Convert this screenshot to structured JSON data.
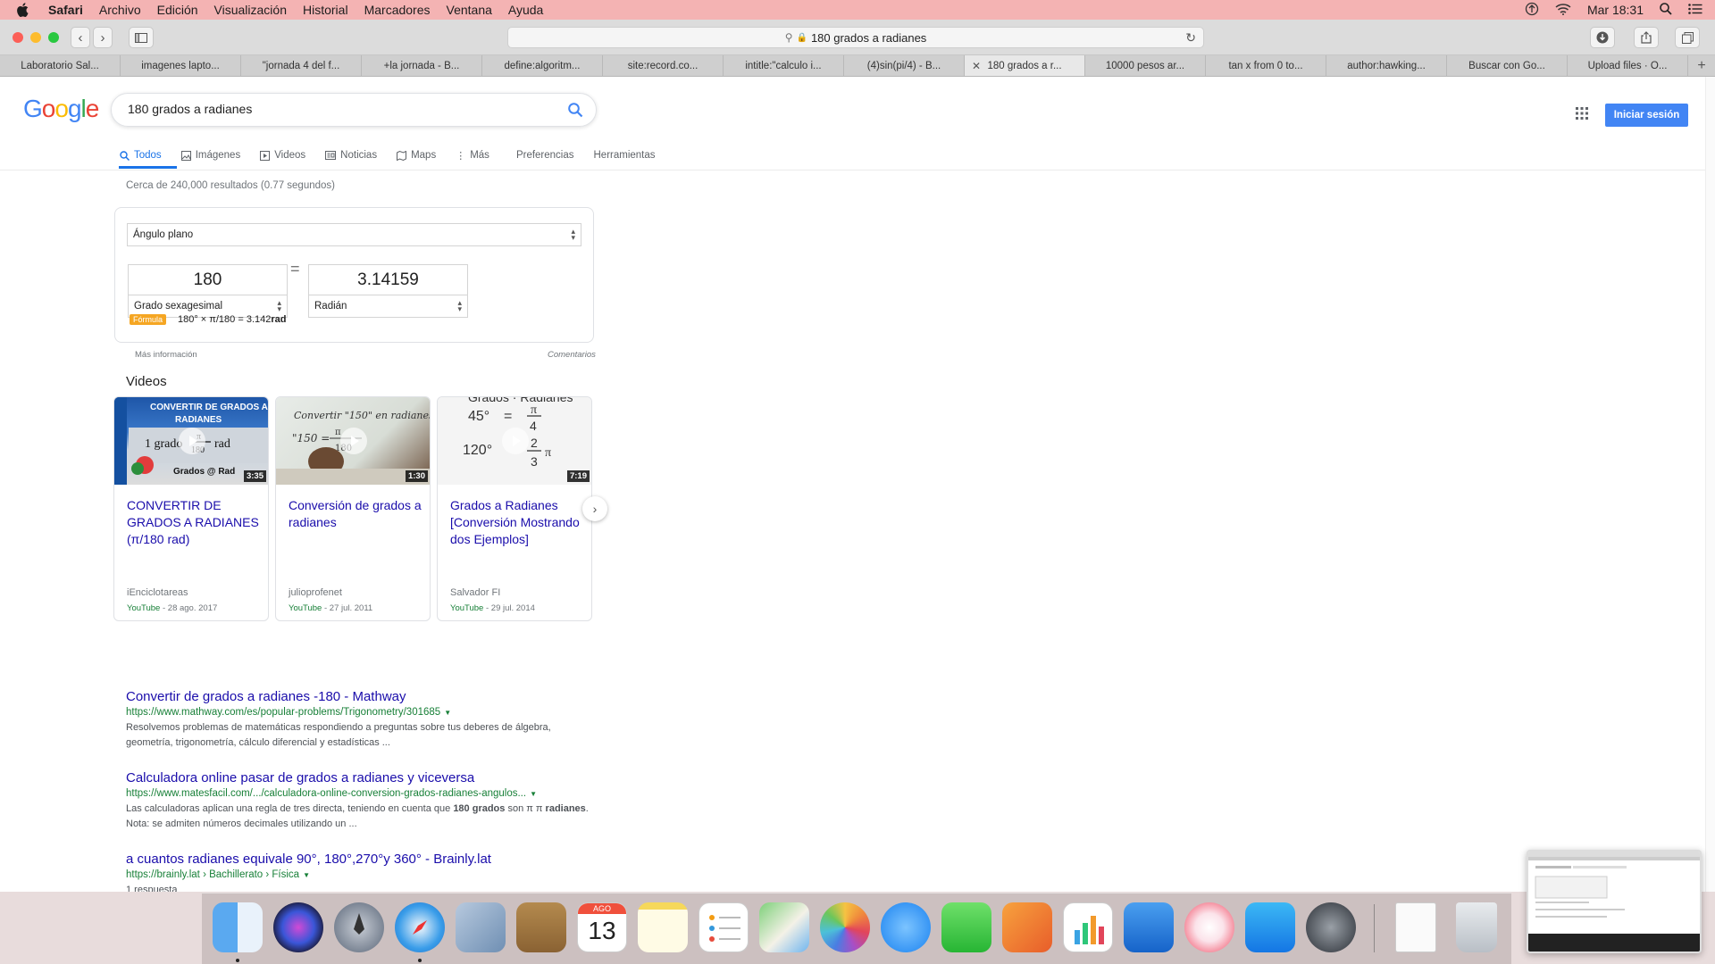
{
  "menubar": {
    "app": "Safari",
    "items": [
      "Archivo",
      "Edición",
      "Visualización",
      "Historial",
      "Marcadores",
      "Ventana",
      "Ayuda"
    ],
    "clock": "Mar 18:31"
  },
  "browser": {
    "address": "180 grados a radianes",
    "tabs": [
      "Laboratorio Sal...",
      "imagenes lapto...",
      "\"jornada 4 del f...",
      "+la jornada - B...",
      "define:algoritm...",
      "site:record.co...",
      "intitle:\"calculo i...",
      "(4)sin(pi/4) - B...",
      "180 grados a r...",
      "10000 pesos ar...",
      "tan x from 0 to...",
      "author:hawking...",
      "Buscar con Go...",
      "Upload files · O..."
    ]
  },
  "google": {
    "logo": "Google",
    "query": "180 grados a radianes",
    "signin": "Iniciar sesión",
    "nav": {
      "todos": "Todos",
      "imagenes": "Imágenes",
      "videos": "Videos",
      "noticias": "Noticias",
      "maps": "Maps",
      "mas": "Más",
      "preferencias": "Preferencias",
      "herramientas": "Herramientas"
    },
    "stats": "Cerca de 240,000 resultados (0.77 segundos)",
    "converter": {
      "unit_type": "Ángulo plano",
      "from_value": "180",
      "to_value": "3.14159",
      "from_unit": "Grado sexagesimal",
      "to_unit": "Radián",
      "formula_label": "Fórmula",
      "formula_text": "180° × π/180 = 3.142",
      "formula_unit": "rad",
      "more_info": "Más información",
      "comments": "Comentarios"
    },
    "videos_heading": "Videos",
    "videos": [
      {
        "title": "CONVERTIR DE GRADOS A RADIANES (π/180 rad)",
        "duration": "3:35",
        "channel": "iEnciclotareas",
        "source": "YouTube",
        "date": " - 28 ago. 2017"
      },
      {
        "title": "Conversión de grados a radianes",
        "duration": "1:30",
        "channel": "julioprofenet",
        "source": "YouTube",
        "date": " - 27 jul. 2011"
      },
      {
        "title": "Grados a Radianes [Conversión Mostrando dos Ejemplos]",
        "duration": "7:19",
        "channel": "Salvador FI",
        "source": "YouTube",
        "date": " - 29 jul. 2014"
      }
    ],
    "results": [
      {
        "title": "Convertir de grados a radianes -180 - Mathway",
        "url": "https://www.mathway.com/es/popular-problems/Trigonometry/301685",
        "snippet": "Resolvemos problemas de matemáticas respondiendo a preguntas sobre tus deberes de álgebra, geometría, trigonometría, cálculo diferencial y estadísticas ..."
      },
      {
        "title": "Calculadora online pasar de grados a radianes y viceversa",
        "url": "https://www.matesfacil.com/.../calculadora-online-conversion-grados-radianes-angulos...",
        "snippet_a": "Las calculadoras aplican una regla de tres directa, teniendo en cuenta que ",
        "snippet_b": "180 grados",
        "snippet_c": " son π π ",
        "snippet_d": "radianes",
        "snippet_e": ". Nota: se admiten números decimales utilizando un ..."
      },
      {
        "title": "a cuantos radianes equivale 90°, 180°,270°y 360° - Brainly.lat",
        "url": "https://brainly.lat › Bachillerato › Física",
        "snippet": "1 respuesta"
      }
    ]
  },
  "dock": {
    "calendar_month": "AGO",
    "calendar_day": "13"
  }
}
